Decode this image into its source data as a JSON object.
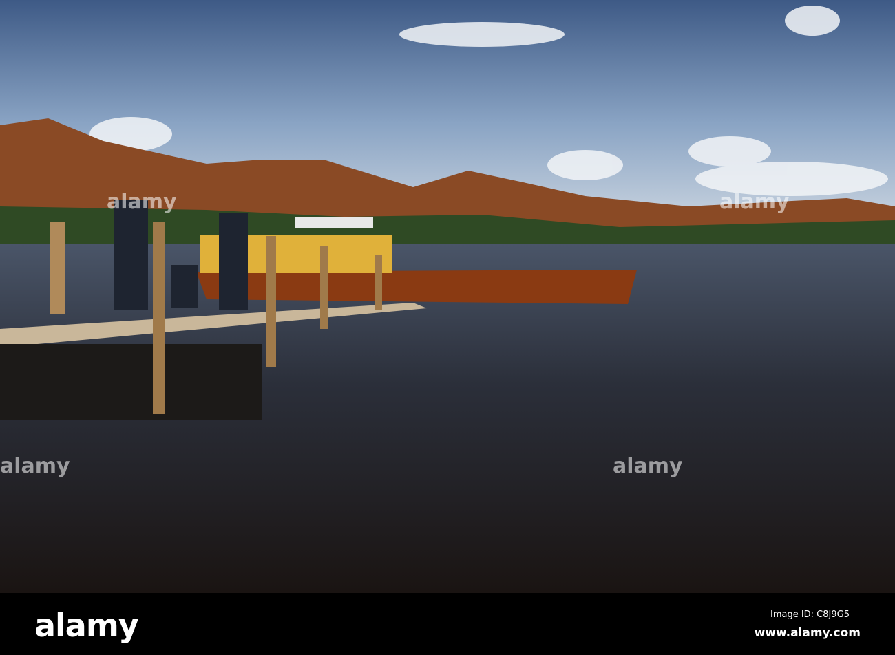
{
  "watermark": {
    "brand": "alamy"
  },
  "footer": {
    "logo": "alamy",
    "image_id": "Image ID: C8J9G5",
    "website": "www.alamy.com"
  }
}
